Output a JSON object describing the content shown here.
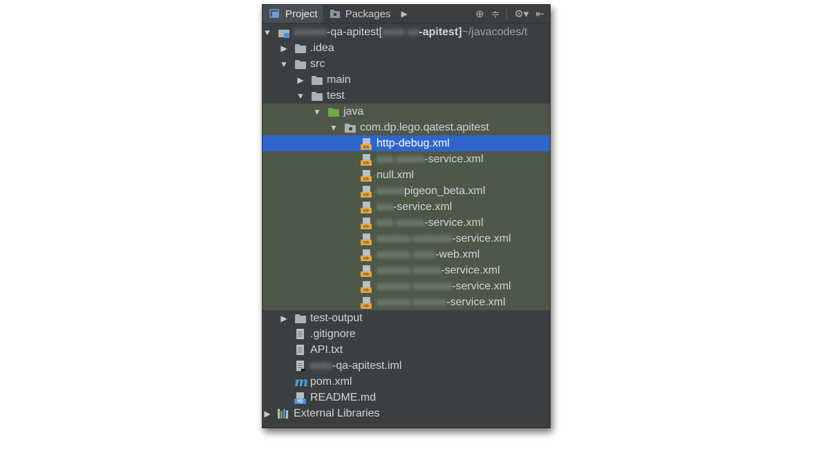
{
  "toolbar": {
    "tabs": [
      {
        "label": "Project",
        "active": true,
        "icon": "project-icon"
      },
      {
        "label": "Packages",
        "active": false,
        "icon": "packages-icon"
      }
    ],
    "more_arrow": "▶",
    "tools": {
      "locate": "⊕",
      "collapse": "≑",
      "settings": "⚙▾",
      "hide": "⇤"
    }
  },
  "tree": {
    "root": {
      "name_blur": "xxxxxx",
      "name": "-qa-apitest",
      "bracket_open": " [",
      "module_blur": "xxxx-xx",
      "module": "-apitest]",
      "path": " ~/javacodes/t"
    },
    "idea": ".idea",
    "src": "src",
    "main": "main",
    "test": "test",
    "java": "java",
    "package": "com.dp.lego.qatest.apitest",
    "files": [
      {
        "blur": "",
        "name": "http-debug.xml"
      },
      {
        "blur": "xxx-xxxxx",
        "name": "-service.xml"
      },
      {
        "blur": "",
        "name": "null.xml"
      },
      {
        "blur": "xxxxx",
        "name": "pigeon_beta.xml"
      },
      {
        "blur": "xxx",
        "name": "-service.xml"
      },
      {
        "blur": "xxx-xxxxx",
        "name": "-service.xml"
      },
      {
        "blur": "xxxxxx-xxxxxxx",
        "name": "-service.xml"
      },
      {
        "blur": "xxxxxx-xxxx",
        "name": "-web.xml"
      },
      {
        "blur": "xxxxxx-xxxxx",
        "name": "-service.xml"
      },
      {
        "blur": "xxxxxx-xxxxxxx",
        "name": "-service.xml"
      },
      {
        "blur": "xxxxxx-xxxxxx",
        "name": "-service.xml"
      }
    ],
    "test_output": "test-output",
    "gitignore": ".gitignore",
    "api_txt": "API.txt",
    "iml": {
      "blur": "xxxx",
      "name": "-qa-apitest.iml"
    },
    "pom": "pom.xml",
    "readme": "README.md",
    "external": "External Libraries"
  },
  "colors": {
    "panel_bg": "#3c3f41",
    "selection": "#2f65ca",
    "scope_green": "#4e5748",
    "xml_badge": "#e3a63a"
  }
}
